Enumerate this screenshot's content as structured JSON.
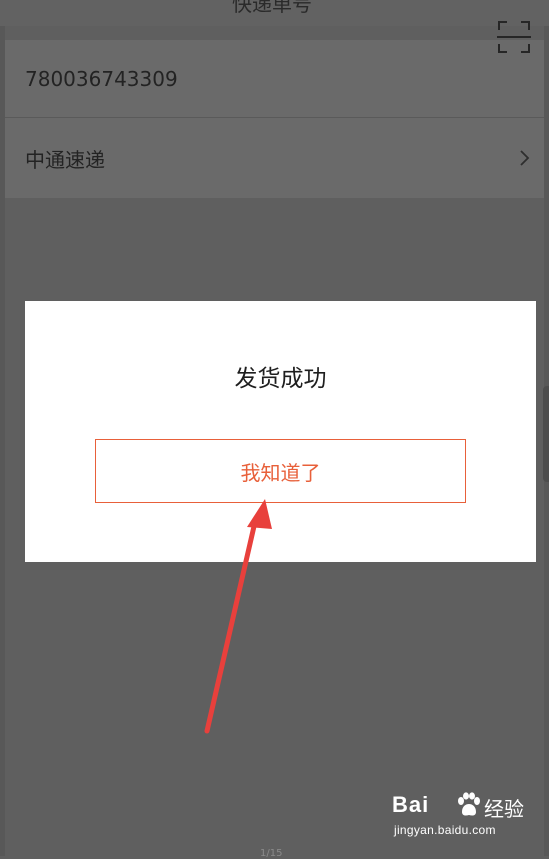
{
  "header": {
    "title_fragment": "快递单号"
  },
  "form": {
    "tracking_number": "780036743309",
    "courier": "中通速递"
  },
  "dialog": {
    "title": "发货成功",
    "ack_button": "我知道了"
  },
  "watermark": {
    "brand": "Bai",
    "jingyan": "经验",
    "url": "jingyan.baidu.com"
  },
  "footer": {
    "fragment": "1/15"
  },
  "colors": {
    "overlay": "#5f5f5f",
    "accent": "#e8603a",
    "annotation_arrow": "#e8403c"
  },
  "icons": [
    "scan-icon",
    "chevron-right-icon",
    "baidu-paw-icon"
  ]
}
